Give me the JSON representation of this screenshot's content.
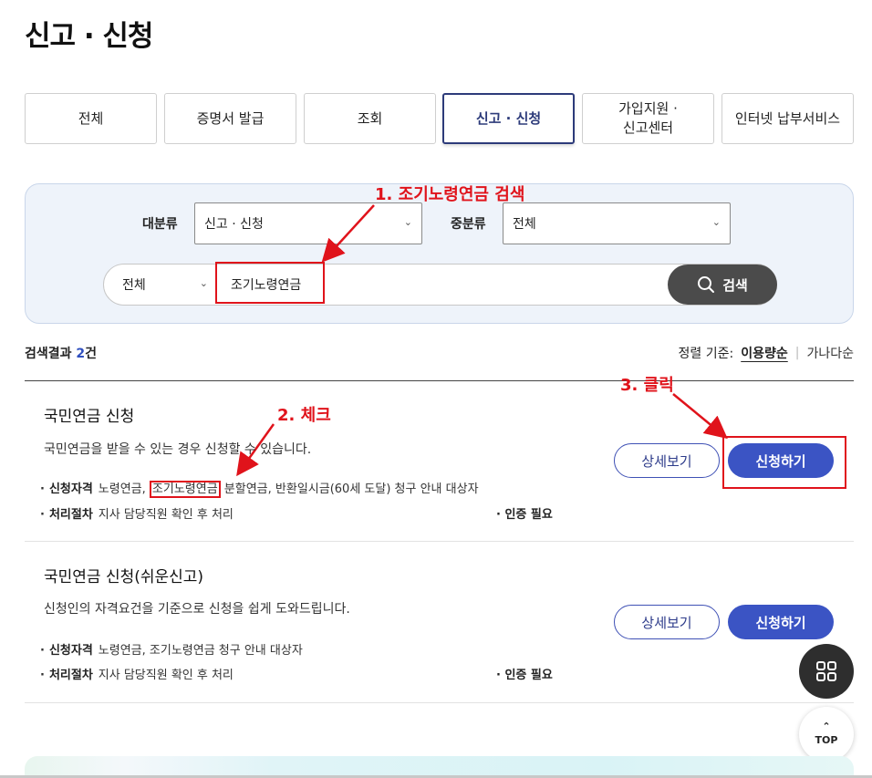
{
  "page": {
    "title": "신고 · 신청"
  },
  "tabs": [
    {
      "label": "전체"
    },
    {
      "label": "증명서 발급"
    },
    {
      "label": "조회"
    },
    {
      "label": "신고 · 신청"
    },
    {
      "label": "가입지원 ·\n신고센터"
    },
    {
      "label": "인터넷 납부서비스"
    }
  ],
  "active_tab": "신고 · 신청",
  "filters": {
    "major_label": "대분류",
    "major_value": "신고 · 신청",
    "middle_label": "중분류",
    "middle_value": "전체",
    "scope_value": "전체",
    "query": "조기노령연금",
    "search_button": "검색"
  },
  "results": {
    "count_label": "검색결과",
    "count_num": "2",
    "count_unit": "건",
    "sort_label": "정렬 기준:",
    "sort_options": [
      "이용량순",
      "가나다순"
    ],
    "sort_selected": "이용량순"
  },
  "items": [
    {
      "title": "국민연금 신청",
      "desc": "국민연금을 받을 수 있는 경우 신청할 수 있습니다.",
      "qual_label": "신청자격",
      "qual_pre": "노령연금, ",
      "qual_highlight": "조기노령연금",
      "qual_post": " 분할연금, 반환일시금(60세 도달) 청구 안내 대상자",
      "proc_label": "처리절차",
      "proc_value": "지사 담당직원 확인 후 처리",
      "auth": "인증 필요",
      "detail_btn": "상세보기",
      "apply_btn": "신청하기"
    },
    {
      "title": "국민연금 신청(쉬운신고)",
      "desc": "신청인의 자격요건을 기준으로 신청을 쉽게 도와드립니다.",
      "qual_label": "신청자격",
      "qual_value": "노령연금, 조기노령연금 청구 안내 대상자",
      "proc_label": "처리절차",
      "proc_value": "지사 담당직원 확인 후 처리",
      "auth": "인증 필요",
      "detail_btn": "상세보기",
      "apply_btn": "신청하기"
    }
  ],
  "annotations": {
    "step1": "1. 조기노령연금 검색",
    "step2": "2. 체크",
    "step3": "3. 클릭",
    "color": "#e0131b"
  },
  "floating": {
    "top_label": "TOP",
    "menu_icon": "grid-icon",
    "top_icon": "caret-up-icon"
  },
  "colors": {
    "primary": "#3b54c4",
    "dark": "#2d3b7a",
    "search_bg": "#eef3fa",
    "search_btn": "#4b4b4b"
  }
}
